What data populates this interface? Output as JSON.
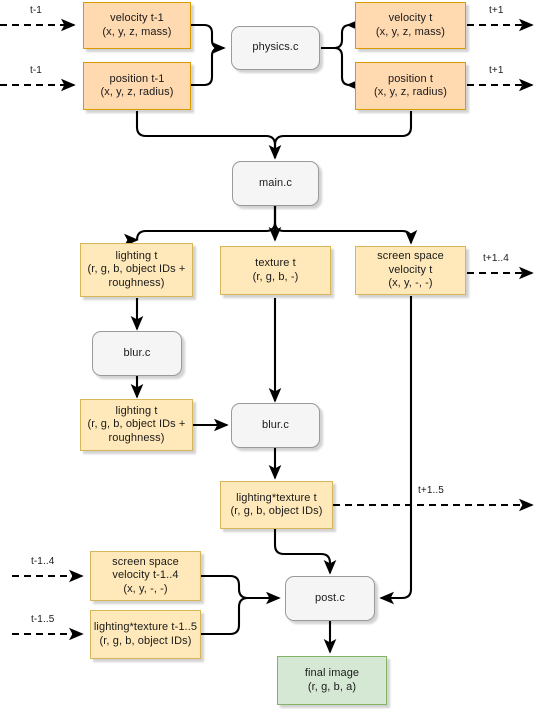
{
  "diagram": {
    "title": "rendering pipeline dataflow",
    "colors": {
      "data_fill": "#ffe9ba",
      "data_stroke": "#d6b656",
      "data_peach_fill": "#ffd9b0",
      "data_peach_stroke": "#d79b00",
      "process_fill": "#f5f5f5",
      "process_stroke": "#9a9a9a",
      "final_fill": "#d5e8d4",
      "final_stroke": "#82b366",
      "edge": "#000000",
      "background": "#ffffff"
    },
    "nodes": [
      {
        "id": "velocity_tm1",
        "kind": "data-peach",
        "lines": [
          "velocity t-1",
          "(x, y, z, mass)"
        ]
      },
      {
        "id": "position_tm1",
        "kind": "data-peach",
        "lines": [
          "position t-1",
          "(x, y, z, radius)"
        ]
      },
      {
        "id": "physics_c",
        "kind": "process",
        "lines": [
          "physics.c"
        ]
      },
      {
        "id": "velocity_t",
        "kind": "data-peach",
        "lines": [
          "velocity t",
          "(x, y, z, mass)"
        ]
      },
      {
        "id": "position_t",
        "kind": "data-peach",
        "lines": [
          "position t",
          "(x, y, z, radius)"
        ]
      },
      {
        "id": "main_c",
        "kind": "process",
        "lines": [
          "main.c"
        ]
      },
      {
        "id": "lighting_t",
        "kind": "data",
        "lines": [
          "lighting t",
          "(r, g, b, object IDs + roughness)"
        ]
      },
      {
        "id": "texture_t",
        "kind": "data",
        "lines": [
          "texture t",
          "(r, g, b, -)"
        ]
      },
      {
        "id": "ss_velocity_t",
        "kind": "data",
        "lines": [
          "screen space",
          "velocity t",
          "(x, y, -, -)"
        ]
      },
      {
        "id": "blur_c_left",
        "kind": "process",
        "lines": [
          "blur.c"
        ]
      },
      {
        "id": "lighting_t_blurred",
        "kind": "data",
        "lines": [
          "lighting t",
          "(r, g, b, object IDs + roughness)"
        ]
      },
      {
        "id": "blur_c_center",
        "kind": "process",
        "lines": [
          "blur.c"
        ]
      },
      {
        "id": "lighting_texture_t",
        "kind": "data",
        "lines": [
          "lighting*texture t",
          "(r, g, b, object IDs)"
        ]
      },
      {
        "id": "ss_velocity_tm14",
        "kind": "data",
        "lines": [
          "screen space",
          "velocity t-1..4",
          "(x, y, -, -)"
        ]
      },
      {
        "id": "lighting_texture_tm15",
        "kind": "data",
        "lines": [
          "lighting*texture t-1..5",
          "(r, g, b, object IDs)"
        ]
      },
      {
        "id": "post_c",
        "kind": "process",
        "lines": [
          "post.c"
        ]
      },
      {
        "id": "final_image",
        "kind": "final",
        "lines": [
          "final image",
          "(r, g, b, a)"
        ]
      }
    ],
    "node_text": {
      "velocity_tm1_l1": "velocity t-1",
      "velocity_tm1_l2": "(x, y, z, mass)",
      "position_tm1_l1": "position t-1",
      "position_tm1_l2": "(x, y, z, radius)",
      "physics_c": "physics.c",
      "velocity_t_l1": "velocity t",
      "velocity_t_l2": "(x, y, z, mass)",
      "position_t_l1": "position t",
      "position_t_l2": "(x, y, z, radius)",
      "main_c": "main.c",
      "lighting_t_l1": "lighting t",
      "lighting_t_l2": "(r, g, b, object IDs + roughness)",
      "texture_t_l1": "texture t",
      "texture_t_l2": "(r, g, b, -)",
      "ss_velocity_t_l1": "screen space",
      "ss_velocity_t_l2": "velocity t",
      "ss_velocity_t_l3": "(x, y, -, -)",
      "blur_c_left": "blur.c",
      "lighting_t_blurred_l1": "lighting t",
      "lighting_t_blurred_l2": "(r, g, b, object IDs + roughness)",
      "blur_c_center": "blur.c",
      "lighting_texture_t_l1": "lighting*texture t",
      "lighting_texture_t_l2": "(r, g, b, object IDs)",
      "ss_velocity_tm14_l1": "screen space",
      "ss_velocity_tm14_l2": "velocity t-1..4",
      "ss_velocity_tm14_l3": "(x, y, -, -)",
      "lighting_texture_tm15_l1": "lighting*texture t-1..5",
      "lighting_texture_tm15_l2": "(r, g, b, object IDs)",
      "post_c": "post.c",
      "final_image_l1": "final image",
      "final_image_l2": "(r, g, b, a)"
    },
    "edge_labels": {
      "in_velocity_tm1": "t-1",
      "in_position_tm1": "t-1",
      "out_velocity_t": "t+1",
      "out_position_t": "t+1",
      "out_ss_velocity_t": "t+1..4",
      "out_lighting_texture_t": "t+1..5",
      "in_ss_velocity_tm14": "t-1..4",
      "in_lighting_texture_tm15": "t-1..5"
    }
  }
}
